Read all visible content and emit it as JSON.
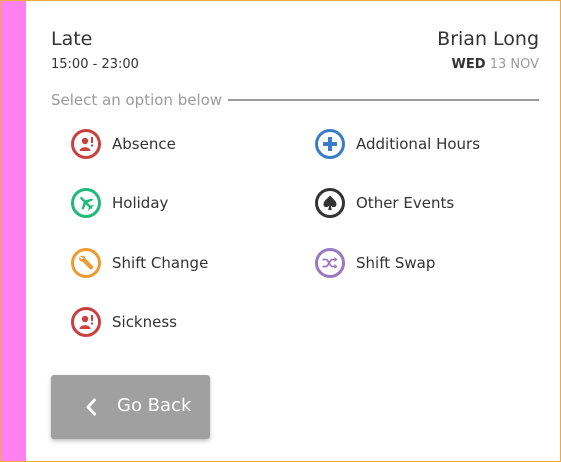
{
  "shift": {
    "name": "Late",
    "time": "15:00 - 23:00"
  },
  "person": {
    "name": "Brian Long",
    "day": "WED",
    "date": "13 NOV"
  },
  "prompt": "Select an option below",
  "options": [
    {
      "label": "Absence",
      "icon": "person-alert-icon",
      "color": "#c94040"
    },
    {
      "label": "Additional Hours",
      "icon": "plus-icon",
      "color": "#3a7bc8"
    },
    {
      "label": "Holiday",
      "icon": "airplane-icon",
      "color": "#1fba78"
    },
    {
      "label": "Other Events",
      "icon": "spade-icon",
      "color": "#333333"
    },
    {
      "label": "Shift Change",
      "icon": "wrench-icon",
      "color": "#ee9a30"
    },
    {
      "label": "Shift Swap",
      "icon": "shuffle-icon",
      "color": "#9b78c4"
    },
    {
      "label": "Sickness",
      "icon": "person-alert-icon",
      "color": "#c94040"
    }
  ],
  "back_button": {
    "label": "Go Back",
    "icon": "chevron-left-icon"
  },
  "colors": {
    "accent_bar": "#ff80f0",
    "frame_border": "#f2a93b",
    "button_bg": "#a0a0a0"
  }
}
